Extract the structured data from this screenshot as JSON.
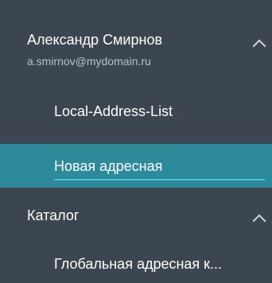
{
  "account": {
    "name": "Александр Смирнов",
    "email": "a.smirnov@mydomain.ru"
  },
  "account_items": [
    {
      "label": "Local-Address-List"
    },
    {
      "label": "Новая адресная"
    }
  ],
  "catalog": {
    "label": "Каталог",
    "items": [
      {
        "label": "Глобальная адресная к..."
      }
    ]
  },
  "colors": {
    "background": "#3b4651",
    "selected_background": "#2c8a9a",
    "selected_underline": "#4ec3d6"
  },
  "icons": {
    "collapse": "chevron-up-icon"
  }
}
